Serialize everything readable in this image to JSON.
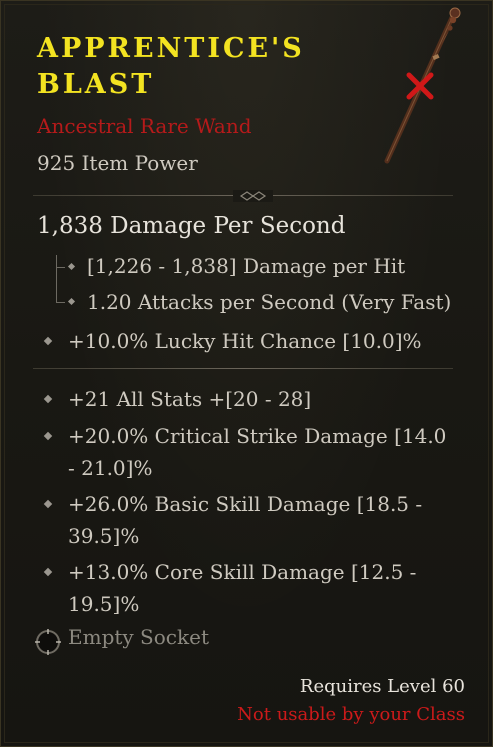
{
  "item": {
    "name": "Apprentice's Blast",
    "rarity": "Ancestral Rare Wand",
    "item_power": "925 Item Power",
    "dps": "1,838 Damage Per Second",
    "damage_per_hit": "[1,226 - 1,838] Damage per Hit",
    "attack_speed": "1.20 Attacks per Second (Very Fast)",
    "implicit": "+10.0% Lucky Hit Chance [10.0]%",
    "affixes": [
      "+21 All Stats +[20 - 28]",
      "+20.0% Critical Strike Damage [14.0 - 21.0]%",
      "+26.0% Basic Skill Damage [18.5 - 39.5]%",
      "+13.0% Core Skill Damage [12.5 - 19.5]%"
    ],
    "socket": "Empty Socket",
    "requires": "Requires Level 60",
    "class_restriction": "Not usable by your Class"
  },
  "colors": {
    "title": "#f3e321",
    "rarity": "#b51a1a",
    "restriction": "#cc1a1a"
  },
  "icons": {
    "wand": "wand-icon",
    "unusable_mark": "red-x-icon",
    "divider": "diamond-ornament-icon",
    "bullet": "diamond-bullet-icon",
    "socket": "socket-icon"
  }
}
